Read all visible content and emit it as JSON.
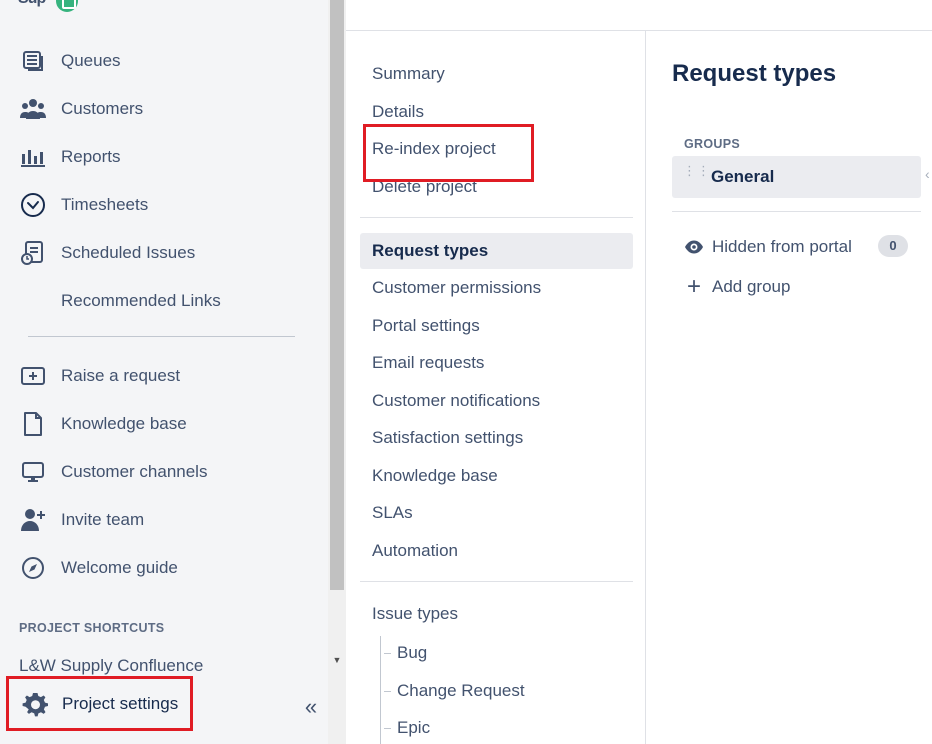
{
  "sidebar": {
    "logo_text": "Sup",
    "items": [
      {
        "label": "Queues",
        "icon": "queues-icon"
      },
      {
        "label": "Customers",
        "icon": "customers-icon"
      },
      {
        "label": "Reports",
        "icon": "reports-icon"
      },
      {
        "label": "Timesheets",
        "icon": "clock-icon"
      },
      {
        "label": "Scheduled Issues",
        "icon": "scheduled-issues-icon"
      },
      {
        "label": "Recommended Links",
        "icon": ""
      }
    ],
    "secondary_items": [
      {
        "label": "Raise a request",
        "icon": "raise-request-icon"
      },
      {
        "label": "Knowledge base",
        "icon": "document-icon"
      },
      {
        "label": "Customer channels",
        "icon": "monitor-icon"
      },
      {
        "label": "Invite team",
        "icon": "add-person-icon"
      },
      {
        "label": "Welcome guide",
        "icon": "compass-icon"
      }
    ],
    "section_label": "PROJECT SHORTCUTS",
    "shortcut": "L&W Supply Confluence",
    "settings_label": "Project settings",
    "collapse_glyph": "«",
    "scroll_arrow": "▼"
  },
  "settings_menu": {
    "top_items": [
      "Summary",
      "Details",
      "Re-index project",
      "Delete project"
    ],
    "middle_items": [
      "Request types",
      "Customer permissions",
      "Portal settings",
      "Email requests",
      "Customer notifications",
      "Satisfaction settings",
      "Knowledge base",
      "SLAs",
      "Automation"
    ],
    "active_item": "Request types",
    "issue_types_label": "Issue types",
    "issue_types": [
      "Bug",
      "Change Request",
      "Epic"
    ]
  },
  "request_types": {
    "title": "Request types",
    "groups_label": "GROUPS",
    "group_selected": "General",
    "hidden_label": "Hidden from portal",
    "hidden_count": "0",
    "add_group_label": "Add group",
    "drag_glyph": "⋮⋮",
    "edge_glyph": "‹"
  },
  "colors": {
    "highlight_border": "#e01c24",
    "sidebar_bg": "#f4f5f7",
    "text_primary": "#172b4d",
    "text_secondary": "#42526e"
  }
}
